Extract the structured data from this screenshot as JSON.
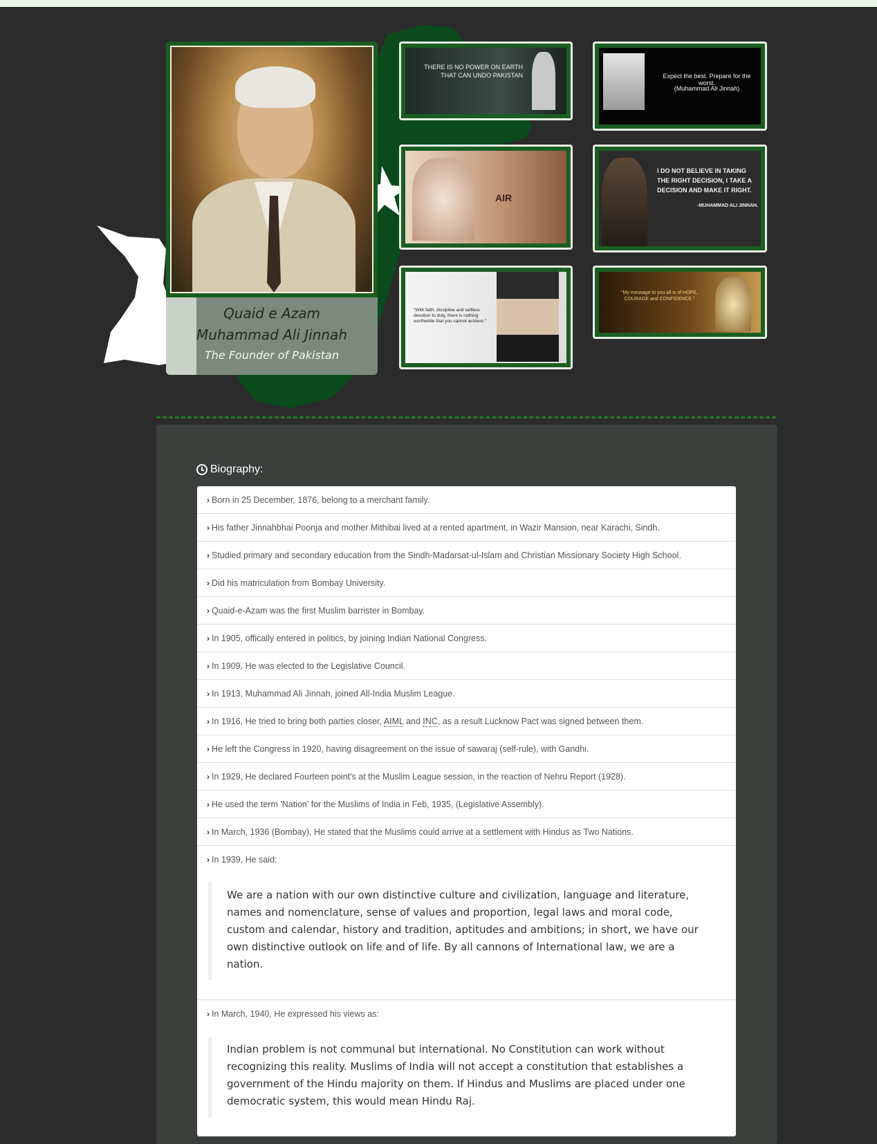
{
  "header": {
    "title_line1": "Quaid e Azam",
    "title_line2": "Muhammad Ali Jinnah",
    "subtitle": "The Founder of Pakistan"
  },
  "thumbnails": [
    {
      "quote": "THERE IS NO POWER ON EARTH THAT CAN UNDO PAKISTAN",
      "attribution": ""
    },
    {
      "quote": "Expect the best. Prepare for the worst.",
      "attribution": "(Muhammad Ali Jinnah)"
    },
    {
      "quote": "AIR",
      "attribution": ""
    },
    {
      "quote": "I DO NOT BELIEVE IN TAKING THE RIGHT DECISION, I TAKE A DECISION AND MAKE IT RIGHT.",
      "attribution": "-MUHAMMAD ALI JINNAH."
    },
    {
      "quote": "\"With faith, discipline and selfless devotion to duty, there is nothing worthwhile that you cannot achieve.\"",
      "attribution": ""
    },
    {
      "quote": "\"My message to you all is of HOPE, COURAGE and CONFIDENCE.\"",
      "attribution": ""
    }
  ],
  "biography": {
    "heading": "Biography:",
    "items": [
      "Born in 25 December, 1876, belong to a merchant family.",
      "His father Jinnahbhai Poonja and mother Mithibai lived at a rented apartment, in Wazir Mansion, near Karachi, Sindh.",
      "Studied primary and secondary education from the Sindh-Madarsat-ul-Islam and Christian Missionary Society High School.",
      "Did his matriculation from Bombay University.",
      "Quaid-e-Azam was the first Muslim barrister in Bombay.",
      "In 1905, offically entered in politics, by joining Indian National Congress.",
      "In 1909, He was elected to the Legislative Council.",
      "In 1913, Muhammad Ali Jinnah, joined All-India Muslim League."
    ],
    "item_1916": {
      "before": "In 1916, He tried to bring both parties closer, ",
      "abbr1": "AIML",
      "and": " and ",
      "abbr2": "INC",
      "after": ", as a result Lucknow Pact was signed between them."
    },
    "items_after": [
      "He left the Congress in 1920, having disagreement on the issue of sawaraj (self-rule), with Gandhi.",
      "In 1929, He declared Fourteen point's at the Muslim League session, in the reaction of Nehru Report (1928).",
      "He used the term 'Nation' for the Muslims of India in Feb, 1935, (Legislative Assembly).",
      "In March, 1936 (Bombay), He stated that the Muslims could arrive at a settlement with Hindus as Two Nations."
    ],
    "quote_1939": {
      "intro": "In 1939, He said:",
      "text": "We are a nation with our own distinctive culture and civilization, language and literature, names and nomenclature, sense of values and proportion, legal laws and moral code, custom and calendar, history and tradition, aptitudes and ambitions; in short, we have our own distinctive outlook on life and of life. By all cannons of International law, we are a nation."
    },
    "quote_1940": {
      "intro": "In March, 1940, He expressed his views as:",
      "text": "Indian problem is not communal but international. No Constitution can work without recognizing this reality. Muslims of India will not accept a constitution that establishes a government of the Hindu majority on them. If Hindus and Muslims are placed under one democratic system, this would mean Hindu Raj."
    }
  },
  "colors": {
    "background": "#2b2b2b",
    "accent_green": "#1b5e22",
    "panel": "#3b3f3c"
  }
}
